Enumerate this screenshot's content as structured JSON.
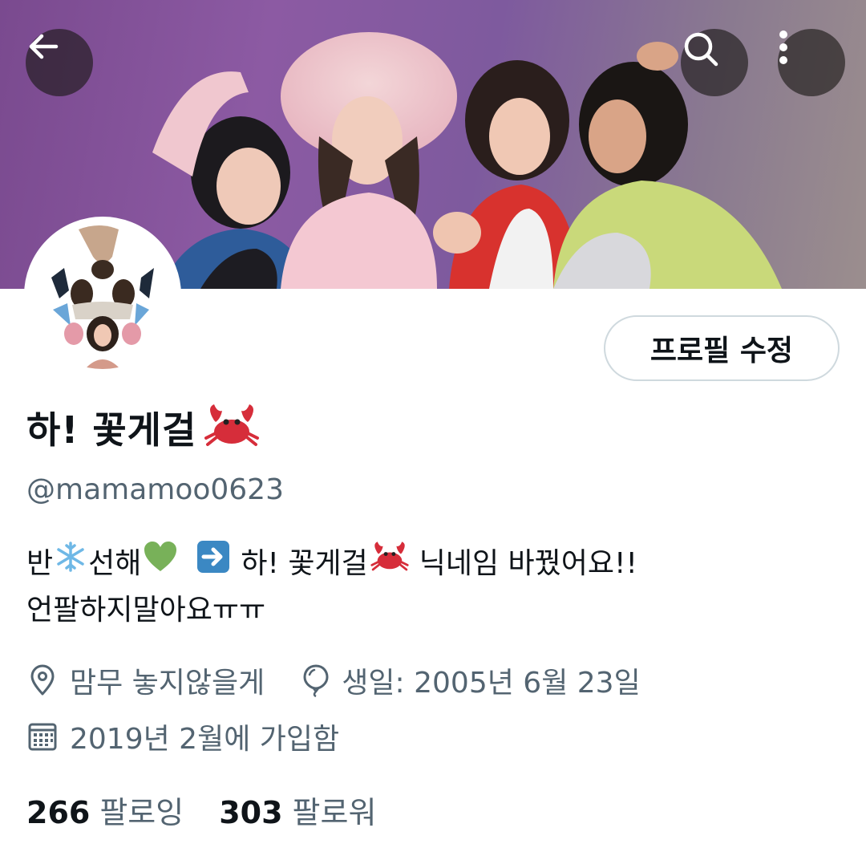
{
  "header": {
    "back_icon": "arrow-left-icon",
    "search_icon": "search-icon",
    "more_icon": "more-vertical-icon"
  },
  "profile": {
    "display_name": "하! 꽃게걸",
    "name_emoji": "crab",
    "handle": "@mamamoo0623",
    "edit_button": "프로필 수정"
  },
  "bio": {
    "line1": [
      {
        "type": "text",
        "value": "반"
      },
      {
        "type": "emoji",
        "value": "snowflake"
      },
      {
        "type": "text",
        "value": "선해"
      },
      {
        "type": "emoji",
        "value": "green-heart"
      },
      {
        "type": "emoji",
        "value": "right-arrow"
      },
      {
        "type": "text",
        "value": "하! 꽃게걸"
      },
      {
        "type": "emoji",
        "value": "crab"
      },
      {
        "type": "text",
        "value": "닉네임 바꿨어요!!"
      }
    ],
    "line1_parts": {
      "a": "반",
      "b": "선해",
      "c": "하! 꽃게걸",
      "d": "닉네임 바꿨어요!!"
    },
    "line2": "언팔하지말아요ㅠㅠ"
  },
  "meta": {
    "location": "맘무 놓지않을게",
    "birthday": "생일: 2005년 6월 23일",
    "joined": "2019년 2월에 가입함",
    "location_icon": "location-pin-icon",
    "birthday_icon": "balloon-icon",
    "joined_icon": "calendar-icon"
  },
  "stats": {
    "following_count": "266",
    "following_label": "팔로잉",
    "followers_count": "303",
    "followers_label": "팔로워"
  },
  "colors": {
    "text_primary": "#0f1419",
    "text_secondary": "#536471",
    "border": "#cfd9de",
    "header_button_bg": "#19161499"
  }
}
